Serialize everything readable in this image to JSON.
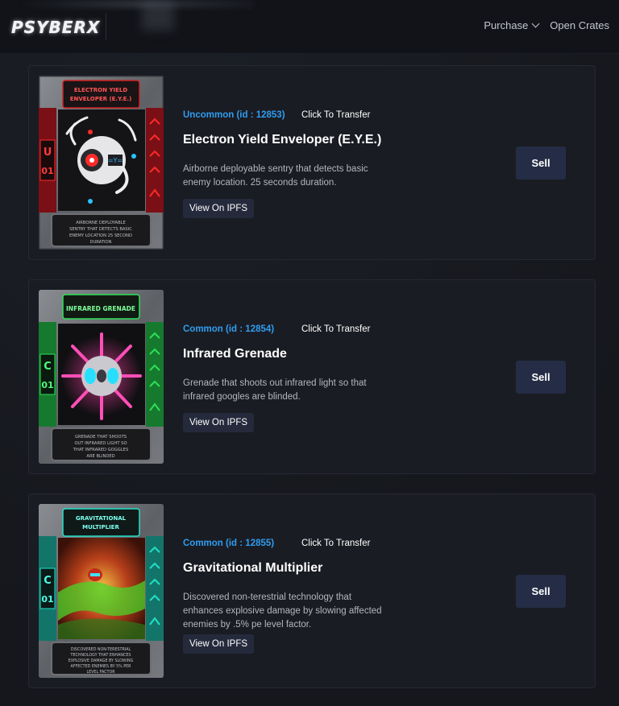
{
  "header": {
    "logo_text": "PSYBERX",
    "nav": [
      {
        "label": "Purchase",
        "has_dropdown": true
      },
      {
        "label": "Open Crates",
        "has_dropdown": false
      }
    ]
  },
  "cards": [
    {
      "rarity": "Uncommon (id : 12853)",
      "transfer_label": "Click To Transfer",
      "name": "Electron Yield Enveloper (E.Y.E.)",
      "description": "Airborne deployable sentry that detects basic enemy location. 25 seconds duration.",
      "ipfs_label": "View On IPFS",
      "sell_label": "Sell",
      "art": {
        "title": "ELECTRON YIELD ENVELOPER (E.Y.E.)",
        "tier": "U",
        "level": "01",
        "accent": "#e0242a",
        "footer_text": "AIRBORNE DEPLOYABLE SENTRY THAT DETECTS BASIC ENEMY LOCATION 25 SECOND DURATION"
      }
    },
    {
      "rarity": "Common (id : 12854)",
      "transfer_label": "Click To Transfer",
      "name": "Infrared Grenade",
      "description": "Grenade that shoots out infrared light so that infrared googles are blinded.",
      "ipfs_label": "View On IPFS",
      "sell_label": "Sell",
      "art": {
        "title": "INFRARED GRENADE",
        "tier": "C",
        "level": "01",
        "accent": "#2ee05a",
        "footer_text": "GRENADE THAT SHOOTS OUT INFRARED LIGHT SO THAT INFRARED GOGGLES ARE BLINDED"
      }
    },
    {
      "rarity": "Common (id : 12855)",
      "transfer_label": "Click To Transfer",
      "name": "Gravitational Multiplier",
      "description": "Discovered non-terestrial technology that enhances explosive damage by slowing affected enemies by .5% pe level factor.",
      "ipfs_label": "View On IPFS",
      "sell_label": "Sell",
      "art": {
        "title": "GRAVITATIONAL MULTIPLIER",
        "tier": "C",
        "level": "01",
        "accent": "#22e0c8",
        "footer_text": "DISCOVERED NON-TERESTRIAL TECHNOLOGY THAT ENHANCES EXPLOSIVE DAMAGE BY SLOWING AFFECTED ENEMIES BY 5% PER LEVEL FACTOR"
      }
    }
  ]
}
